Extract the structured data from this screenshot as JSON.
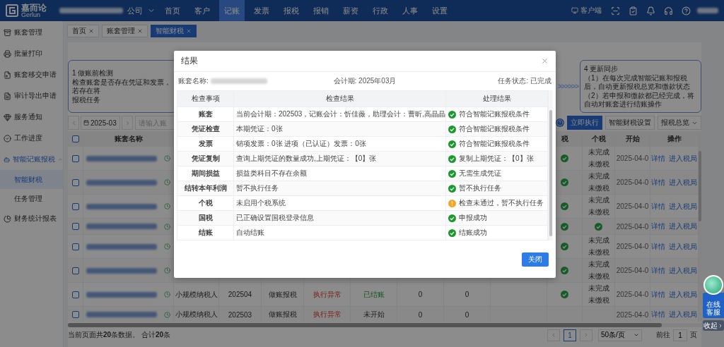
{
  "top_bar": {
    "brand": "嘉而论",
    "brand_sub": "Gerlun",
    "company": "公司",
    "client_label": "客户端",
    "menu": [
      {
        "label": "首页",
        "selected": false
      },
      {
        "label": "客户",
        "selected": false
      },
      {
        "label": "记账",
        "selected": true
      },
      {
        "label": "发票",
        "selected": false
      },
      {
        "label": "报税",
        "selected": false
      },
      {
        "label": "报销",
        "selected": false
      },
      {
        "label": "薪资",
        "selected": false
      },
      {
        "label": "行政",
        "selected": false
      },
      {
        "label": "人事",
        "selected": false
      },
      {
        "label": "设置",
        "selected": false
      }
    ]
  },
  "sidebar": {
    "items": [
      {
        "label": "账套管理",
        "selected": false
      },
      {
        "label": "批量打印",
        "selected": false
      },
      {
        "label": "账套移交申请",
        "selected": false
      },
      {
        "label": "审计导出申请",
        "selected": false
      },
      {
        "label": "服务通知",
        "selected": false
      },
      {
        "label": "工作进度",
        "selected": false
      },
      {
        "label": "智能记账报税",
        "selected": true,
        "expanded": true,
        "children": [
          {
            "label": "智能财税",
            "selected": true
          },
          {
            "label": "任务管理",
            "selected": false
          }
        ]
      },
      {
        "label": "财务统计报表",
        "selected": false
      }
    ]
  },
  "tabs": [
    {
      "label": "首页",
      "selected": false
    },
    {
      "label": "账套管理",
      "selected": false
    },
    {
      "label": "智能财税",
      "selected": true
    }
  ],
  "steps": [
    {
      "title": "1 做账前检测",
      "lines": [
        "检查账套是否存在凭证和发票，若存在将",
        "报税任务"
      ]
    },
    {
      "title": "4 更新同步",
      "lines": [
        "（1）在每次完成智能记账和报税后，自动更新报税总览和缴款状态",
        "（2）若申报和缴款都已经完成，将自动对账套进行结账操作"
      ]
    }
  ],
  "steps_arrow": ">>>>>>",
  "toolbar": {
    "period": "2025-03",
    "search_placeholder": "请输入账",
    "buttons": [
      {
        "label": "立即执行",
        "kind": "primary"
      },
      {
        "label": "智能财税设置",
        "kind": "default"
      },
      {
        "label": "报税总览",
        "kind": "split"
      }
    ]
  },
  "table": {
    "select_all_checked": false,
    "headers": {
      "name": "账套名称",
      "tax": "税",
      "personal_tax": "个税",
      "start": "开始",
      "actions": "操作"
    },
    "rows": [
      {
        "checked": false,
        "tax_done": true,
        "personal_tax": {
          "kind": "text",
          "lines": [
            "未完成",
            "未缴税"
          ]
        },
        "start": "2025-04-0",
        "actions": [
          "详情",
          "进入税局"
        ]
      },
      {
        "checked": false,
        "tax_done": true,
        "personal_tax": {
          "kind": "text",
          "lines": [
            "未完成",
            "未缴税"
          ]
        },
        "start": "2025-04-0",
        "actions": [
          "详情",
          "进入税局"
        ]
      },
      {
        "checked": false,
        "tax_done": true,
        "personal_tax": {
          "kind": "text",
          "lines": [
            "未完成",
            "未缴税"
          ]
        },
        "start": "2025-04-0",
        "actions": [
          "详情",
          "进入税局"
        ]
      },
      {
        "checked": false,
        "tax_done": true,
        "personal_tax": {
          "kind": "done"
        },
        "start": "2025-04-0",
        "actions": [
          "详情",
          "进入税局"
        ]
      },
      {
        "checked": false,
        "tax_done": true,
        "personal_tax": {
          "kind": "text",
          "lines": [
            "未完成",
            "未缴税"
          ]
        },
        "start": "2025-04-0",
        "actions": [
          "详情",
          "进入税局"
        ]
      },
      {
        "checked": false,
        "tax_done": true,
        "personal_tax": {
          "kind": "text",
          "lines": [
            "未完成",
            "未缴税"
          ]
        },
        "start": "2025-04-0",
        "actions": [
          "详情",
          "进入税局"
        ]
      },
      {
        "checked": false,
        "type": "小规模纳税人",
        "period": "202504",
        "task": "做账报税",
        "exec_status": {
          "label": "执行异常",
          "kind": "error"
        },
        "close_status": {
          "label": "已结账",
          "kind": "success"
        },
        "column_8": "0",
        "column_9": "0",
        "tax_done": true,
        "personal_tax": {
          "kind": "text",
          "lines": [
            "未完成",
            "未缴税"
          ]
        },
        "start": "2025-04-0",
        "actions": [
          "详情",
          "进入税局"
        ]
      },
      {
        "checked": false,
        "type": "小规模纳税人",
        "period": "202503",
        "task": "做账报税",
        "exec_status": {
          "label": "执行异常",
          "kind": "error"
        },
        "close_status": {
          "label": "未开始",
          "kind": "neutral"
        },
        "column_8": "0",
        "column_9": "0",
        "tax_done": false,
        "start": "2025-04-0",
        "actions": [
          "详情",
          "进入税局"
        ]
      }
    ]
  },
  "footer": {
    "summary": "当前页面共**20**条数据。 合计**20**条",
    "pages": [
      {
        "label": "1",
        "selected": true
      }
    ],
    "page_size": "50条/页",
    "goto_label": "前往",
    "goto_value": "1",
    "page_suffix": "页"
  },
  "support_widget": {
    "label": "在线客服",
    "collapse": "收起"
  },
  "modal": {
    "title": "结果",
    "account_label": "账套名称:",
    "period": "会计期: 2025年03月",
    "status": "任务状态: 已完成",
    "close_button": "关闭",
    "columns": [
      "检查事项",
      "检查结果",
      "处理结果"
    ],
    "rows": [
      {
        "item": "账套",
        "result": "当前会计期：202503，记账会计：忻佳薇，助理会计：曹昕,高晶晶",
        "outcome": "符合智能记账报税条件",
        "kind": "ok"
      },
      {
        "item": "凭证检查",
        "result": "本期凭证：0张",
        "outcome": "符合智能记账报税条件",
        "kind": "ok"
      },
      {
        "item": "发票",
        "result": "销项发票：0张 进项（已认证）发票：0张",
        "outcome": "符合智能记账报税条件",
        "kind": "ok"
      },
      {
        "item": "凭证复制",
        "result": "查询上期凭证的数量成功,上期凭证：【0】张",
        "outcome": "复制上期凭证：【0】张",
        "kind": "ok"
      },
      {
        "item": "期间损益",
        "result": "损益类科目不存在余额",
        "outcome": "无需生成凭证",
        "kind": "ok"
      },
      {
        "item": "结转本年利润",
        "result": "暂不执行任务",
        "outcome": "暂不执行任务",
        "kind": "ok"
      },
      {
        "item": "个税",
        "result": "未启用个税系统",
        "outcome": "检查未通过，暂不执行任务",
        "kind": "warn"
      },
      {
        "item": "国税",
        "result": "已正确设置国税登录信息",
        "outcome": "申报成功",
        "kind": "ok"
      },
      {
        "item": "结账",
        "result": "自动结账",
        "outcome": "结账成功",
        "kind": "ok"
      }
    ]
  }
}
